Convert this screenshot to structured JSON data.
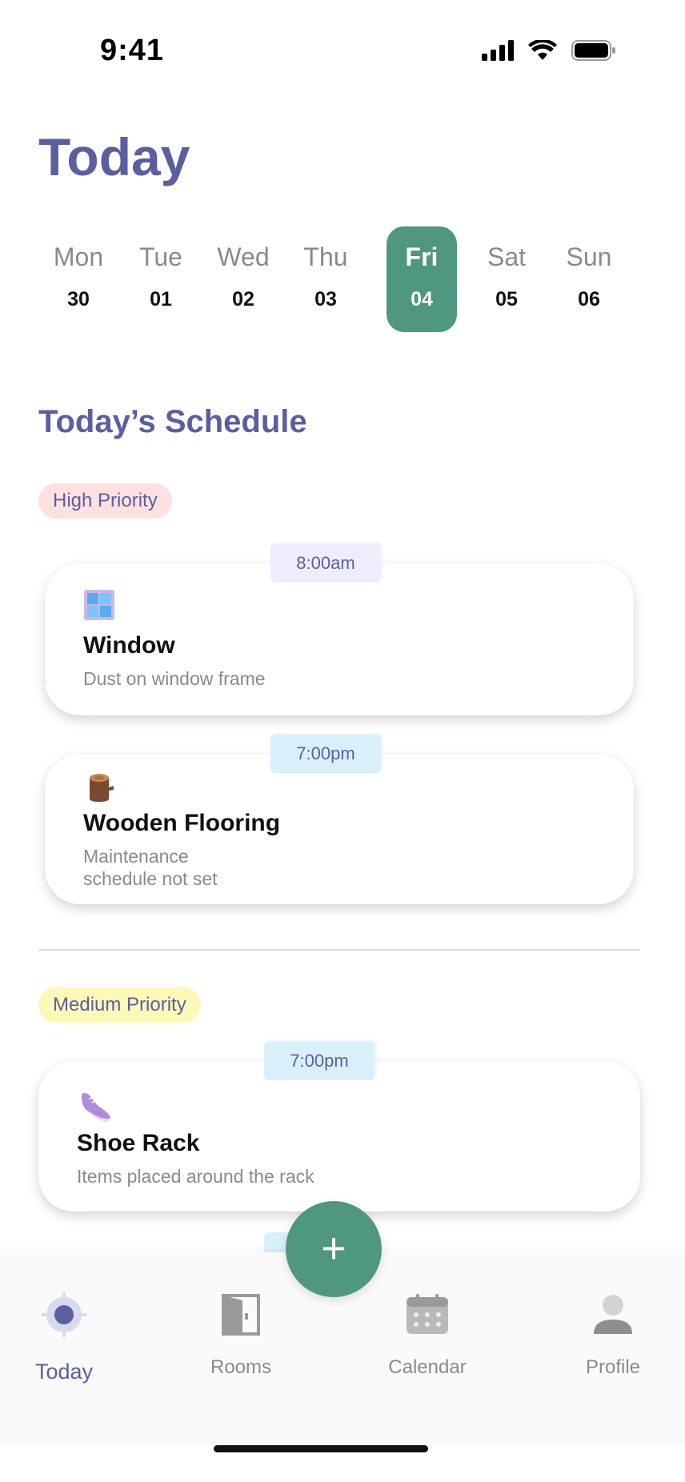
{
  "status_bar": {
    "time": "9:41"
  },
  "header": {
    "title": "Today"
  },
  "week": {
    "days": [
      {
        "name": "Mon",
        "date": "30"
      },
      {
        "name": "Tue",
        "date": "01"
      },
      {
        "name": "Wed",
        "date": "02"
      },
      {
        "name": "Thu",
        "date": "03"
      },
      {
        "name": "Fri",
        "date": "04",
        "selected": true
      },
      {
        "name": "Sat",
        "date": "05"
      },
      {
        "name": "Sun",
        "date": "06"
      }
    ]
  },
  "schedule": {
    "title": "Today’s Schedule",
    "groups": [
      {
        "priority": "High Priority",
        "tasks": [
          {
            "time": "8:00am",
            "title": "Window",
            "subtitle": "Dust on window frame",
            "icon": "window-icon"
          },
          {
            "time": "7:00pm",
            "title": "Wooden Flooring",
            "subtitle_line1": "Maintenance",
            "subtitle_line2": "schedule not set",
            "icon": "log-icon"
          }
        ]
      },
      {
        "priority": "Medium Priority",
        "tasks": [
          {
            "time": "7:00pm",
            "title": "Shoe Rack",
            "subtitle": "Items placed around the rack",
            "icon": "sneaker-icon"
          }
        ]
      }
    ]
  },
  "fab": {
    "label": "+"
  },
  "tabbar": {
    "items": [
      {
        "label": "Today",
        "icon": "target-icon",
        "active": true
      },
      {
        "label": "Rooms",
        "icon": "door-icon"
      },
      {
        "label": "Calendar",
        "icon": "calendar-icon"
      },
      {
        "label": "Profile",
        "icon": "person-icon"
      }
    ]
  },
  "colors": {
    "primary": "#5a5fa0",
    "accent": "#4f977f",
    "high": "#fde0e0",
    "medium": "#fcf8b8"
  }
}
